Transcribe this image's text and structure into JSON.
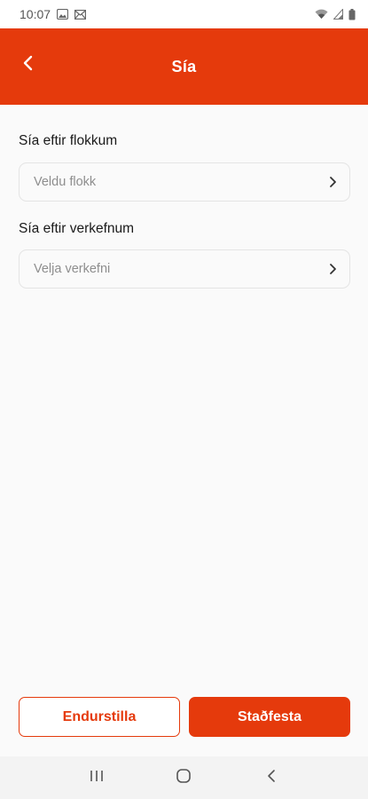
{
  "status_bar": {
    "time": "10:07",
    "icons": [
      "image-icon",
      "mail-icon",
      "wifi-icon",
      "signal-icon",
      "battery-icon"
    ]
  },
  "header": {
    "title": "Sía",
    "back_icon": "chevron-left-icon",
    "color": "#e53a0c"
  },
  "filters": [
    {
      "label": "Sía eftir flokkum",
      "placeholder": "Veldu flokk"
    },
    {
      "label": "Sía eftir verkefnum",
      "placeholder": "Velja verkefni"
    }
  ],
  "actions": {
    "reset_label": "Endurstilla",
    "confirm_label": "Staðfesta"
  },
  "nav_bar": {
    "icons": [
      "recent-apps-icon",
      "home-icon",
      "back-icon"
    ]
  }
}
